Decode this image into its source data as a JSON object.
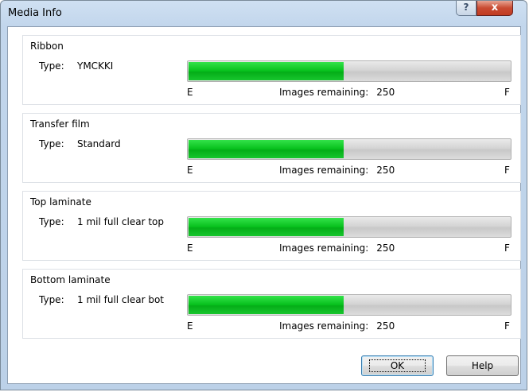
{
  "window": {
    "title": "Media Info",
    "help_glyph": "?",
    "close_glyph": "x"
  },
  "groups": [
    {
      "title": "Ribbon",
      "type_label": "Type:",
      "type_value": "YMCKKI",
      "level_fraction": 0.48,
      "empty_label": "E",
      "full_label": "F",
      "remaining_label": "Images remaining:",
      "remaining_value": "250"
    },
    {
      "title": "Transfer film",
      "type_label": "Type:",
      "type_value": "Standard",
      "level_fraction": 0.48,
      "empty_label": "E",
      "full_label": "F",
      "remaining_label": "Images remaining:",
      "remaining_value": "250"
    },
    {
      "title": "Top laminate",
      "type_label": "Type:",
      "type_value": "1 mil full clear top",
      "level_fraction": 0.48,
      "empty_label": "E",
      "full_label": "F",
      "remaining_label": "Images remaining:",
      "remaining_value": "250"
    },
    {
      "title": "Bottom laminate",
      "type_label": "Type:",
      "type_value": "1 mil full clear bot",
      "level_fraction": 0.48,
      "empty_label": "E",
      "full_label": "F",
      "remaining_label": "Images remaining:",
      "remaining_value": "250"
    }
  ],
  "buttons": {
    "ok_label": "OK",
    "help_label": "Help"
  },
  "colors": {
    "fill": "#06c01c",
    "track": "#d4d4d4"
  }
}
